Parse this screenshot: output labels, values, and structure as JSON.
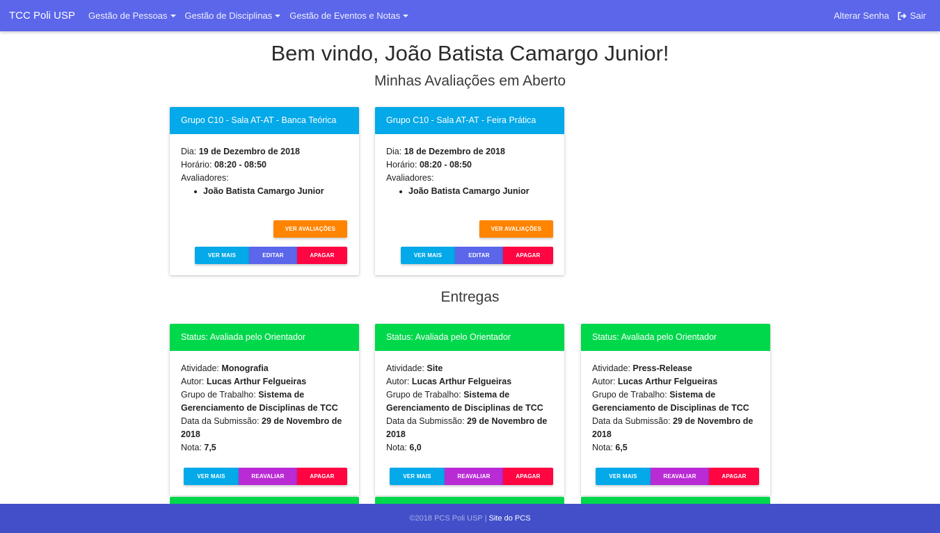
{
  "navbar": {
    "brand": "TCC Poli USP",
    "menus": [
      "Gestão de Pessoas",
      "Gestão de Disciplinas",
      "Gestão de Eventos e Notas"
    ],
    "change_password": "Alterar Senha",
    "signout": "Sair"
  },
  "header": {
    "welcome": "Bem vindo, João Batista Camargo Junior!",
    "subtitle": "Minhas Avaliações em Aberto"
  },
  "evaluations": [
    {
      "title": "Grupo C10 - Sala AT-AT - Banca Teórica",
      "day_label": "Dia:",
      "day": "19 de Dezembro de 2018",
      "time_label": "Horário:",
      "time": "08:20 - 08:50",
      "evaluators_label": "Avaliadores:",
      "evaluator": "João Batista Camargo Junior",
      "view_evals": "VER AVALIAÇÕES",
      "more": "VER MAIS",
      "edit": "EDITAR",
      "delete": "APAGAR"
    },
    {
      "title": "Grupo C10 - Sala AT-AT - Feira Prática",
      "day_label": "Dia:",
      "day": "18 de Dezembro de 2018",
      "time_label": "Horário:",
      "time": "08:20 - 08:50",
      "evaluators_label": "Avaliadores:",
      "evaluator": "João Batista Camargo Junior",
      "view_evals": "VER AVALIAÇÕES",
      "more": "VER MAIS",
      "edit": "EDITAR",
      "delete": "APAGAR"
    }
  ],
  "deliveries_title": "Entregas",
  "deliveries": [
    {
      "status": "Status: Avaliada pelo Orientador",
      "activity_label": "Atividade:",
      "activity": "Monografia",
      "author_label": "Autor:",
      "author": "Lucas Arthur Felgueiras",
      "group_label": "Grupo de Trabalho:",
      "group": "Sistema de Gerenciamento de Disciplinas de TCC",
      "date_label": "Data da Submissão:",
      "date": "29 de Novembro de 2018",
      "grade_label": "Nota:",
      "grade": "7,5",
      "more": "VER MAIS",
      "reevaluate": "REAVALIAR",
      "delete": "APAGAR"
    },
    {
      "status": "Status: Avaliada pelo Orientador",
      "activity_label": "Atividade:",
      "activity": "Site",
      "author_label": "Autor:",
      "author": "Lucas Arthur Felgueiras",
      "group_label": "Grupo de Trabalho:",
      "group": "Sistema de Gerenciamento de Disciplinas de TCC",
      "date_label": "Data da Submissão:",
      "date": "29 de Novembro de 2018",
      "grade_label": "Nota:",
      "grade": "6,0",
      "more": "VER MAIS",
      "reevaluate": "REAVALIAR",
      "delete": "APAGAR"
    },
    {
      "status": "Status: Avaliada pelo Orientador",
      "activity_label": "Atividade:",
      "activity": "Press-Release",
      "author_label": "Autor:",
      "author": "Lucas Arthur Felgueiras",
      "group_label": "Grupo de Trabalho:",
      "group": "Sistema de Gerenciamento de Disciplinas de TCC",
      "date_label": "Data da Submissão:",
      "date": "29 de Novembro de 2018",
      "grade_label": "Nota:",
      "grade": "6,5",
      "more": "VER MAIS",
      "reevaluate": "REAVALIAR",
      "delete": "APAGAR"
    }
  ],
  "footer": {
    "copyright": "©2018 PCS Poli USP",
    "separator": "|",
    "link": "Site do PCS"
  },
  "colors": {
    "navbar": "#5b66ea",
    "footer": "#424fc9",
    "header_blue": "#03a9e8",
    "header_green": "#00d84b",
    "orange": "#ff8400",
    "red": "#ff0541",
    "purple": "#b92bd5"
  },
  "icons": {
    "signout": "sign-out-icon",
    "dropdown": "caret-down-icon"
  }
}
